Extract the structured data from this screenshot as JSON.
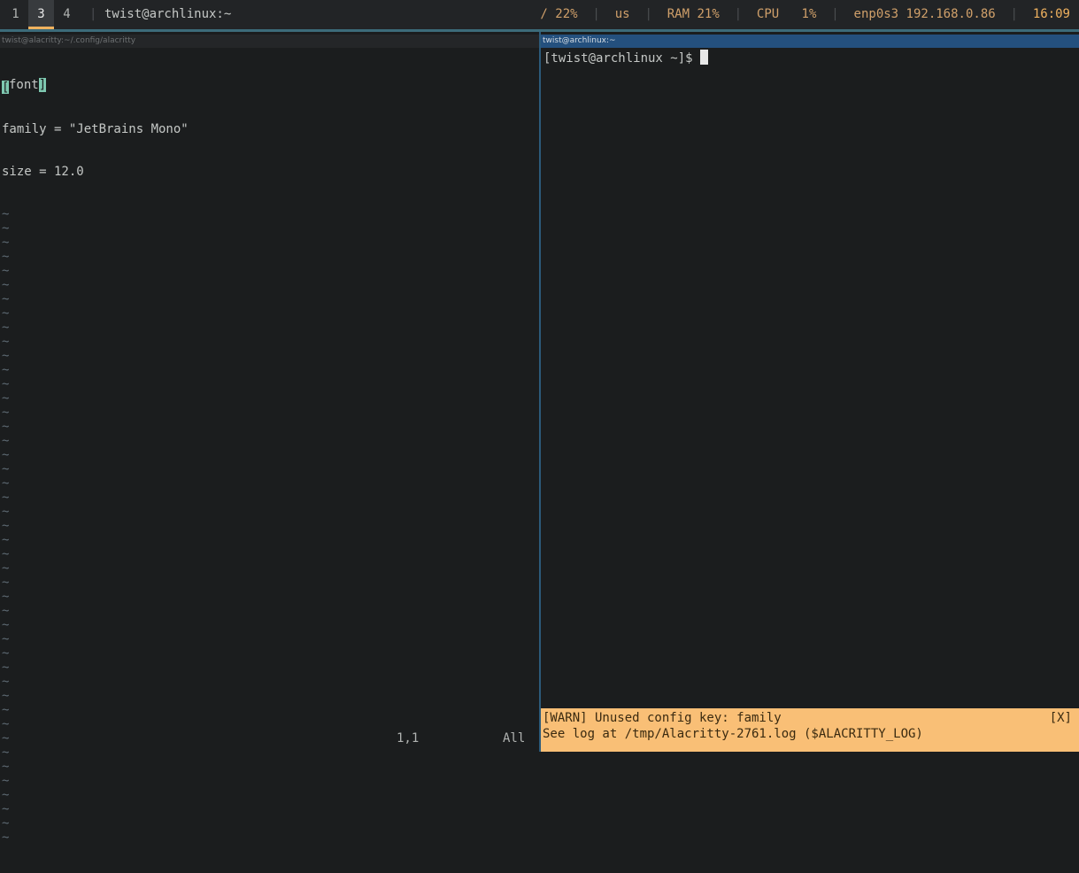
{
  "bar": {
    "workspaces": [
      "1",
      "3",
      "4"
    ],
    "active_workspace": "3",
    "window_title": "twist@archlinux:~",
    "disk": "/ 22%",
    "keyboard_layout": "us",
    "ram": "RAM 21%",
    "cpu_label": "CPU",
    "cpu_value": "1%",
    "network": "enp0s3 192.168.0.86",
    "clock": "16:09",
    "accent_color": "#f0b25f"
  },
  "left_pane": {
    "title": "twist@alacritty:~/.config/alacritty",
    "lines": {
      "line1_bracket_open": "[",
      "line1_key": "font",
      "line1_bracket_close": "]",
      "line2": "family = \"JetBrains Mono\"",
      "line3": "size = 12.0"
    },
    "tilde": "~",
    "cursor_position": "1,1",
    "scroll_position": "All"
  },
  "right_pane": {
    "title": "twist@archlinux:~",
    "prompt": "[twist@archlinux ~]$"
  },
  "warning": {
    "line1": "[WARN] Unused config key: family",
    "line2": "See log at /tmp/Alacritty-2761.log ($ALACRITTY_LOG)",
    "close": "[X]",
    "color": "#f9bf76"
  }
}
